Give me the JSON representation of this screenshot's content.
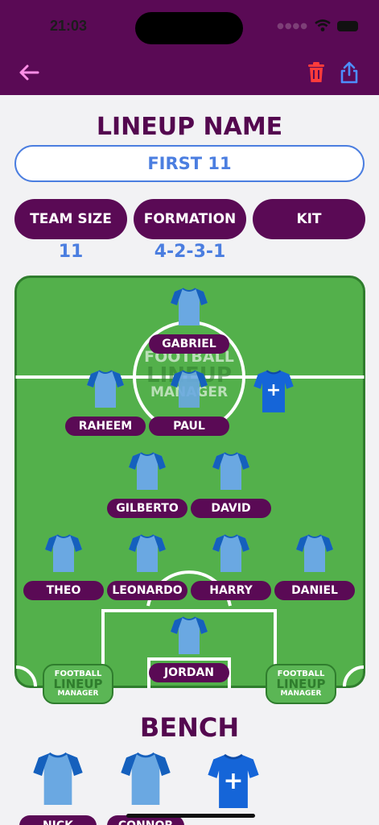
{
  "status_bar": {
    "time": "21:03"
  },
  "lineup": {
    "heading": "LINEUP NAME",
    "name_value": "FIRST 11"
  },
  "settings": [
    {
      "label": "TEAM SIZE",
      "value": "11"
    },
    {
      "label": "FORMATION",
      "value": "4-2-3-1"
    },
    {
      "label": "KIT",
      "value": ""
    }
  ],
  "pitch": {
    "watermark": {
      "line1": "FOOTBALL",
      "line2": "LINEUP",
      "line3": "MANAGER"
    },
    "players": [
      {
        "name": "GABRIEL"
      },
      {
        "name": "RAHEEM"
      },
      {
        "name": "PAUL"
      },
      {
        "name": "GILBERTO"
      },
      {
        "name": "DAVID"
      },
      {
        "name": "THEO"
      },
      {
        "name": "LEONARDO"
      },
      {
        "name": "HARRY"
      },
      {
        "name": "DANIEL"
      },
      {
        "name": "JORDAN"
      }
    ],
    "add_player_symbol": "+"
  },
  "badge": {
    "line1": "FOOTBALL",
    "line2": "LINEUP",
    "line3": "MANAGER"
  },
  "bench": {
    "heading": "BENCH",
    "players": [
      {
        "name": "NICK"
      },
      {
        "name": "CONNOR"
      }
    ],
    "add_symbol": "+"
  },
  "colors": {
    "brand_purple": "#5a0a55",
    "accent_blue": "#4b7ee0",
    "pitch_green": "#53b04b",
    "shirt_light": "#6aa8e2",
    "shirt_dark": "#1560bd",
    "delete_red": "#ff3b3b"
  },
  "icons": {
    "back": "arrow-left-icon",
    "delete": "trash-icon",
    "share": "share-icon"
  }
}
